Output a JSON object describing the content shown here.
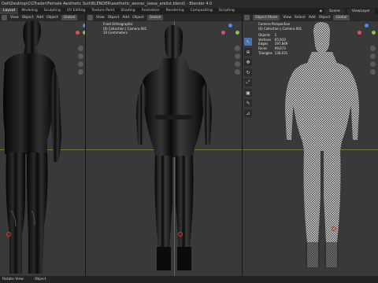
{
  "window": {
    "title": "Dell\\Desktop\\CGTrader\\Female Aesthetic Suit\\BLENDER\\aesthetic_aesrac_(aesa_arelist.blend) - Blender 4.0"
  },
  "tabs": [
    "Layout",
    "Modeling",
    "Sculpting",
    "UV Editing",
    "Texture Paint",
    "Shading",
    "Animation",
    "Rendering",
    "Compositing",
    "Scripting"
  ],
  "top_right": {
    "scene_label": "Scene",
    "view_layer_label": "ViewLayer"
  },
  "viewport1": {
    "header": {
      "mode": "",
      "items": [
        "View",
        "Object",
        "Add",
        "Object",
        "Global"
      ]
    }
  },
  "viewport2": {
    "header": {
      "mode": "",
      "items": [
        "View",
        "Object",
        "Add",
        "Object",
        "Global"
      ]
    },
    "info_lines": [
      "Front Orthographic",
      "(0) Collection | Camera.001",
      "10 Centimeters"
    ]
  },
  "viewport3": {
    "header": {
      "mode": "Object Mode",
      "items": [
        "View",
        "Select",
        "Add",
        "Object",
        "Global"
      ]
    },
    "info_lines": [
      "Camera Perspective",
      "(0) Collection | Camera.001"
    ],
    "stats": [
      {
        "label": "Objects",
        "value": "1"
      },
      {
        "label": "Vertices",
        "value": "65,933"
      },
      {
        "label": "Edges",
        "value": "197,849"
      },
      {
        "label": "Faces",
        "value": "99,673"
      },
      {
        "label": "Triangles",
        "value": "130,031"
      }
    ]
  },
  "statusbar": {
    "left": "Rotate View",
    "middle": "Object"
  },
  "colors": {
    "x_axis": "#e84a5f",
    "y_axis": "#8cc24a",
    "z_axis": "#4b8ee8",
    "horizon": "#6d7a3c"
  },
  "icons": [
    "move-icon",
    "zoom-icon",
    "hand-icon",
    "camera-icon",
    "grid-icon",
    "cursor-icon",
    "rotate-icon",
    "scale-icon",
    "transform-icon",
    "annotate-icon",
    "measure-icon"
  ]
}
